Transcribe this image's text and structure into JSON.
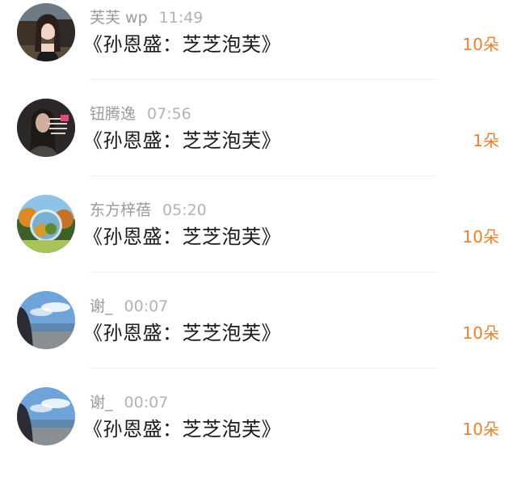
{
  "comments": [
    {
      "user": "芙芙 wp",
      "time": "11:49",
      "message": "《孙恩盛：芝芝泡芙》",
      "gift": "10朵",
      "avatar": "woman-portrait-car-icon"
    },
    {
      "user": "钮腾逸",
      "time": "07:56",
      "message": "《孙恩盛：芝芝泡芙》",
      "gift": "1朵",
      "avatar": "woman-dark-text-icon"
    },
    {
      "user": "东方梓蓓",
      "time": "05:20",
      "message": "《孙恩盛：芝芝泡芙》",
      "gift": "10朵",
      "avatar": "globe-autumn-trees-icon"
    },
    {
      "user": "谢_",
      "time": "00:07",
      "message": "《孙恩盛：芝芝泡芙》",
      "gift": "10朵",
      "avatar": "beach-sky-girl-icon"
    },
    {
      "user": "谢_",
      "time": "00:07",
      "message": "《孙恩盛：芝芝泡芙》",
      "gift": "10朵",
      "avatar": "beach-sky-girl-icon"
    }
  ],
  "colors": {
    "username": "#9b9b9b",
    "message": "#1a1a1a",
    "gift": "#f07f2a",
    "divider": "#f0f0f0"
  }
}
